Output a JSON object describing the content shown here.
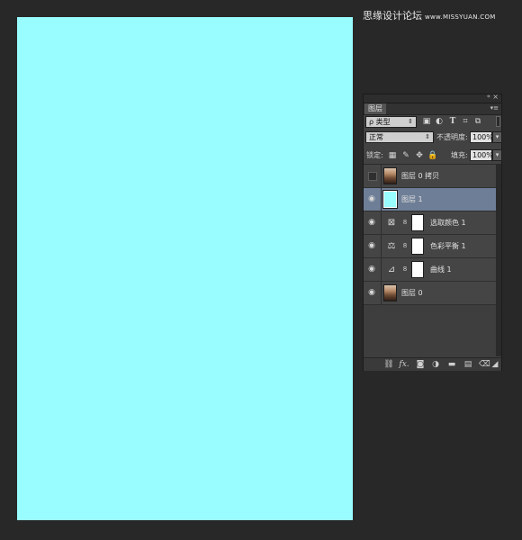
{
  "watermark": {
    "text": "思缘设计论坛",
    "url": "www.MISSYUAN.COM"
  },
  "panel": {
    "collapse_icon": "«",
    "close_icon": "×",
    "tab_label": "图层",
    "panel_menu_icon": "▾≡",
    "filter": {
      "kind_label": "ρ 类型",
      "icons": [
        "image-filter-icon",
        "adjustment-filter-icon",
        "type-filter-icon",
        "shape-filter-icon",
        "smart-object-filter-icon"
      ]
    },
    "blend_mode": "正常",
    "opacity_label": "不透明度:",
    "opacity_value": "100%",
    "lock_label": "锁定:",
    "fill_label": "填充:",
    "fill_value": "100%",
    "layers": [
      {
        "name": "图层 0 拷贝",
        "visible": false,
        "selected": false,
        "thumbnail": "photo"
      },
      {
        "name": "图层 1",
        "visible": true,
        "selected": true,
        "thumbnail": "color-fill",
        "color": "#99fcfe"
      },
      {
        "name": "选取颜色 1",
        "visible": true,
        "selected": false,
        "thumbnail": "selective-color-icon"
      },
      {
        "name": "色彩平衡 1",
        "visible": true,
        "selected": false,
        "thumbnail": "color-balance-icon"
      },
      {
        "name": "曲线 1",
        "visible": true,
        "selected": false,
        "thumbnail": "curves-icon"
      },
      {
        "name": "图层 0",
        "visible": true,
        "selected": false,
        "thumbnail": "photo"
      }
    ],
    "bottom_icons": [
      "link-layers-icon",
      "fx-icon",
      "add-mask-icon",
      "new-adjustment-icon",
      "new-group-icon",
      "new-layer-icon",
      "trash-icon"
    ],
    "bottom_fx_text": "fx."
  },
  "canvas": {
    "color": "#99fcfe"
  },
  "colors": {
    "app_bg": "#282828",
    "panel_bg": "#424242",
    "selected_row": "#6d7e96"
  }
}
